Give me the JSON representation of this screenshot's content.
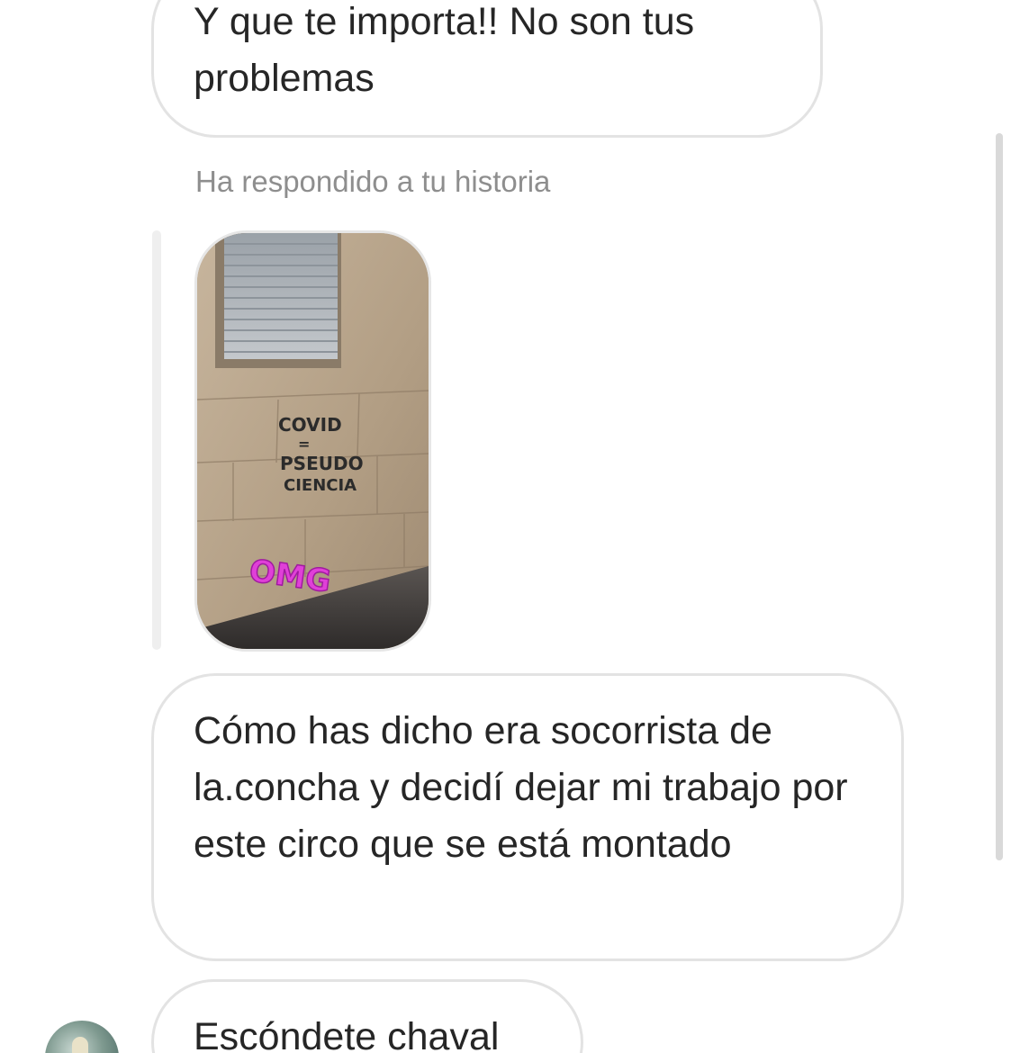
{
  "messages": [
    {
      "id": "msg-1",
      "text": "Y que te importa!! No son tus problemas"
    },
    {
      "id": "msg-2",
      "text": "Cómo has dicho era socorrista de la.concha y decidí dejar mi trabajo por este circo que se está montado"
    },
    {
      "id": "msg-3",
      "text": "Escóndete chaval"
    }
  ],
  "story_reply": {
    "note": "Ha respondido a tu historia",
    "image": {
      "graffiti_lines": [
        "COVID",
        "=",
        "PSEUDO",
        "CIENCIA"
      ],
      "sticker": "OMG",
      "sticker_color": "#e040d8"
    }
  },
  "colors": {
    "bubble_border": "#e3e3e3",
    "text": "#262626",
    "meta_text": "#8e8e8e"
  }
}
